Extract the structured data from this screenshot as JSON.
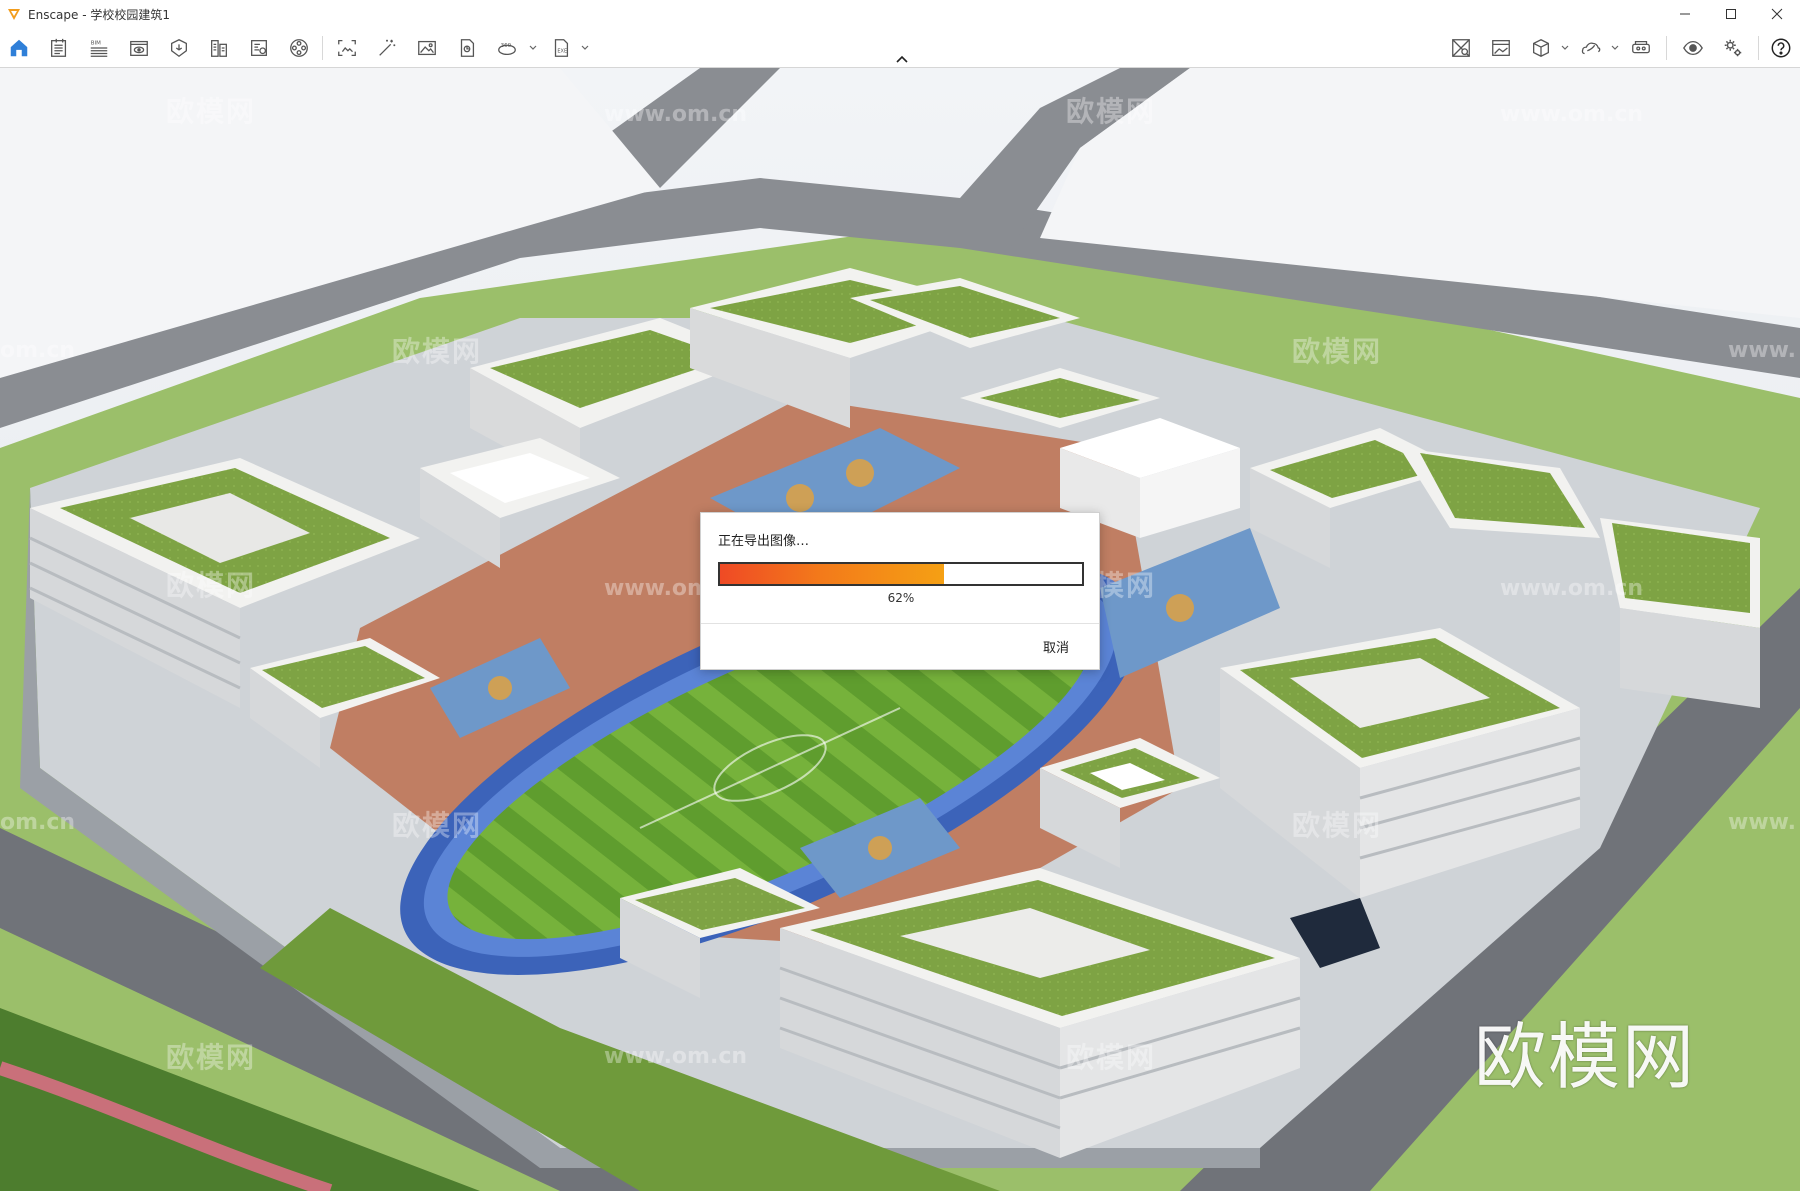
{
  "window": {
    "title": "Enscape - 学校校园建筑1",
    "accent_color": "#f29d1d"
  },
  "toolbar": {
    "left_icons": [
      "home-icon",
      "document-icon",
      "bim-icon",
      "view-icon",
      "asset-icon",
      "library-icon",
      "material-icon",
      "video-icon",
      "screenshot-icon",
      "magic-icon",
      "image-icon",
      "batch-icon",
      "panorama-360-icon",
      "export-exe-icon"
    ],
    "right_icons": [
      "map-icon",
      "gallery-icon",
      "cube-icon",
      "cloud-icon",
      "vr-headset-icon",
      "visual-settings-icon",
      "settings-icon",
      "help-icon"
    ]
  },
  "watermarks": {
    "cn": "欧模网",
    "url": "www.om.cn",
    "url_partial_left": "om.cn",
    "url_partial_right": "www.",
    "logo": "欧模网"
  },
  "dialog": {
    "title": "正在导出图像…",
    "progress_percent": 62,
    "progress_label": "62%",
    "cancel_label": "取消"
  }
}
